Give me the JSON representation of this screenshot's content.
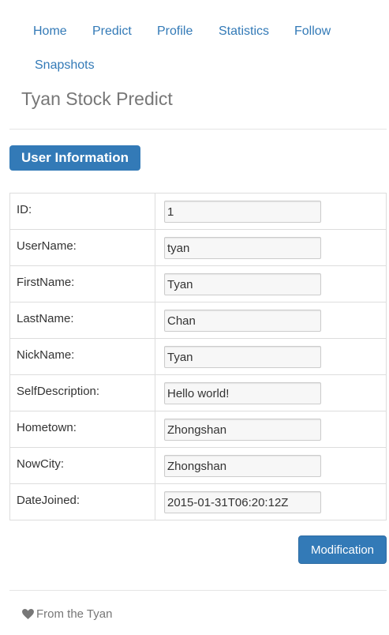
{
  "nav": {
    "items": [
      {
        "label": "Home"
      },
      {
        "label": "Predict"
      },
      {
        "label": "Profile"
      },
      {
        "label": "Statistics"
      },
      {
        "label": "Follow"
      },
      {
        "label": "Snapshots"
      }
    ]
  },
  "brand": "Tyan Stock Predict",
  "section_label": "User Information",
  "user_info": {
    "rows": [
      {
        "label": "ID:",
        "value": "1"
      },
      {
        "label": "UserName:",
        "value": "tyan"
      },
      {
        "label": "FirstName:",
        "value": "Tyan"
      },
      {
        "label": "LastName:",
        "value": "Chan"
      },
      {
        "label": "NickName:",
        "value": "Tyan"
      },
      {
        "label": "SelfDescription:",
        "value": "Hello world!"
      },
      {
        "label": "Hometown:",
        "value": "Zhongshan"
      },
      {
        "label": "NowCity:",
        "value": "Zhongshan"
      },
      {
        "label": "DateJoined:",
        "value": "2015-01-31T06:20:12Z"
      }
    ]
  },
  "modify_button": "Modification",
  "footer": {
    "icon": "heart-icon",
    "text": "From the Tyan"
  },
  "colors": {
    "primary": "#337ab7",
    "brand_text": "#777777",
    "border": "#dddddd"
  }
}
